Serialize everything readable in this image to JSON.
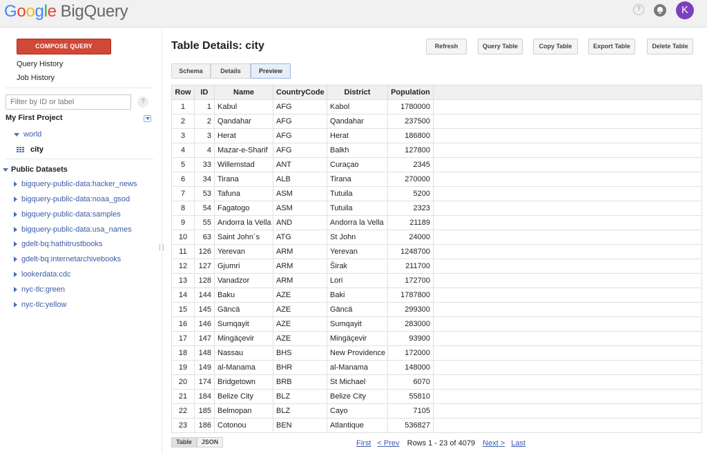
{
  "header": {
    "logo_google": [
      "G",
      "o",
      "o",
      "g",
      "l",
      "e"
    ],
    "logo_product": "BigQuery",
    "help_glyph": "?",
    "avatar_initial": "K",
    "avatar_color": "#7b3fbf"
  },
  "sidebar": {
    "compose_label": "COMPOSE QUERY",
    "compose_color": "#d14836",
    "query_history": "Query History",
    "job_history": "Job History",
    "filter_placeholder": "Filter by ID or label",
    "filter_help": "?",
    "project_name": "My First Project",
    "project_datasets": [
      {
        "label": "world",
        "expanded": true,
        "icon": "triangle-down-icon"
      }
    ],
    "project_tables": [
      {
        "label": "city",
        "icon": "table-icon",
        "selected": true
      }
    ],
    "public_header": "Public Datasets",
    "public_datasets": [
      "bigquery-public-data:hacker_news",
      "bigquery-public-data:noaa_gsod",
      "bigquery-public-data:samples",
      "bigquery-public-data:usa_names",
      "gdelt-bq:hathitrustbooks",
      "gdelt-bq:internetarchivebooks",
      "lookerdata:cdc",
      "nyc-tlc:green",
      "nyc-tlc:yellow"
    ]
  },
  "main": {
    "title": "Table Details: city",
    "actions": [
      "Refresh",
      "Query Table",
      "Copy Table",
      "Export Table",
      "Delete Table"
    ],
    "tabs": [
      "Schema",
      "Details",
      "Preview"
    ],
    "active_tab": "Preview",
    "columns": [
      "Row",
      "ID",
      "Name",
      "CountryCode",
      "District",
      "Population"
    ],
    "rows": [
      [
        "1",
        "1",
        "Kabul",
        "AFG",
        "Kabol",
        "1780000"
      ],
      [
        "2",
        "2",
        "Qandahar",
        "AFG",
        "Qandahar",
        "237500"
      ],
      [
        "3",
        "3",
        "Herat",
        "AFG",
        "Herat",
        "186800"
      ],
      [
        "4",
        "4",
        "Mazar-e-Sharif",
        "AFG",
        "Balkh",
        "127800"
      ],
      [
        "5",
        "33",
        "Willemstad",
        "ANT",
        "Curaçao",
        "2345"
      ],
      [
        "6",
        "34",
        "Tirana",
        "ALB",
        "Tirana",
        "270000"
      ],
      [
        "7",
        "53",
        "Tafuna",
        "ASM",
        "Tutuila",
        "5200"
      ],
      [
        "8",
        "54",
        "Fagatogo",
        "ASM",
        "Tutuila",
        "2323"
      ],
      [
        "9",
        "55",
        "Andorra la Vella",
        "AND",
        "Andorra la Vella",
        "21189"
      ],
      [
        "10",
        "63",
        "Saint John´s",
        "ATG",
        "St John",
        "24000"
      ],
      [
        "11",
        "126",
        "Yerevan",
        "ARM",
        "Yerevan",
        "1248700"
      ],
      [
        "12",
        "127",
        "Gjumri",
        "ARM",
        "Širak",
        "211700"
      ],
      [
        "13",
        "128",
        "Vanadzor",
        "ARM",
        "Lori",
        "172700"
      ],
      [
        "14",
        "144",
        "Baku",
        "AZE",
        "Baki",
        "1787800"
      ],
      [
        "15",
        "145",
        "Gäncä",
        "AZE",
        "Gäncä",
        "299300"
      ],
      [
        "16",
        "146",
        "Sumqayit",
        "AZE",
        "Sumqayit",
        "283000"
      ],
      [
        "17",
        "147",
        "Mingäçevir",
        "AZE",
        "Mingäçevir",
        "93900"
      ],
      [
        "18",
        "148",
        "Nassau",
        "BHS",
        "New Providence",
        "172000"
      ],
      [
        "19",
        "149",
        "al-Manama",
        "BHR",
        "al-Manama",
        "148000"
      ],
      [
        "20",
        "174",
        "Bridgetown",
        "BRB",
        "St Michael",
        "6070"
      ],
      [
        "21",
        "184",
        "Belize City",
        "BLZ",
        "Belize City",
        "55810"
      ],
      [
        "22",
        "185",
        "Belmopan",
        "BLZ",
        "Cayo",
        "7105"
      ],
      [
        "23",
        "186",
        "Cotonou",
        "BEN",
        "Atlantique",
        "536827"
      ]
    ],
    "view_tabs": [
      "Table",
      "JSON"
    ],
    "active_view": "Table",
    "pager": {
      "first": "First",
      "prev": "< Prev",
      "status": "Rows 1 - 23 of 4079",
      "next": "Next >",
      "last": "Last"
    }
  }
}
